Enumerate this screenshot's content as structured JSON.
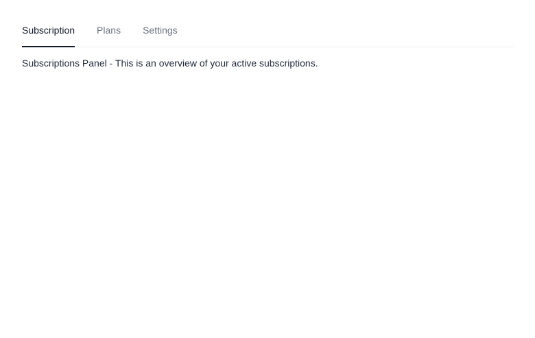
{
  "tabs": [
    {
      "label": "Subscription",
      "active": true
    },
    {
      "label": "Plans",
      "active": false
    },
    {
      "label": "Settings",
      "active": false
    }
  ],
  "panel": {
    "text": "Subscriptions Panel - This is an overview of your active subscriptions."
  },
  "colors": {
    "active_tab": "#111827",
    "inactive_tab": "#6b7280",
    "divider": "#e5e7eb"
  }
}
